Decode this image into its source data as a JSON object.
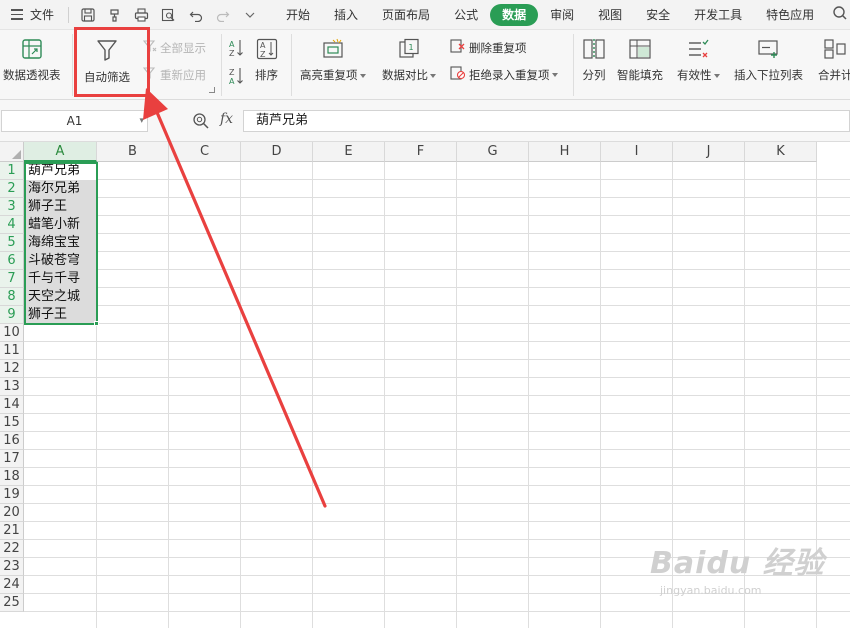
{
  "menubar": {
    "file_label": "文件",
    "tabs": [
      "开始",
      "插入",
      "页面布局",
      "公式",
      "数据",
      "审阅",
      "视图",
      "安全",
      "开发工具",
      "特色应用"
    ],
    "active_tab": "数据"
  },
  "ribbon": {
    "pivot_label": "数据透视表",
    "autofilter_label": "自动筛选",
    "show_all_label": "全部显示",
    "reapply_label": "重新应用",
    "sort_label": "排序",
    "highlight_dup_label": "高亮重复项",
    "compare_label": "数据对比",
    "remove_dup_label": "删除重复项",
    "reject_dup_label": "拒绝录入重复项",
    "split_label": "分列",
    "smart_fill_label": "智能填充",
    "validity_label": "有效性",
    "dropdown_label": "插入下拉列表",
    "merge_label": "合并计"
  },
  "formula_bar": {
    "name_box": "A1",
    "fx_label": "fx",
    "content": "葫芦兄弟"
  },
  "sheet": {
    "columns": [
      "A",
      "B",
      "C",
      "D",
      "E",
      "F",
      "G",
      "H",
      "I",
      "J",
      "K"
    ],
    "rows": [
      "1",
      "2",
      "3",
      "4",
      "5",
      "6",
      "7",
      "8",
      "9",
      "10",
      "11",
      "12",
      "13",
      "14",
      "15",
      "16",
      "17",
      "18",
      "19",
      "20",
      "21",
      "22",
      "23",
      "24",
      "25"
    ],
    "selected_column": "A",
    "cells_a": [
      "葫芦兄弟",
      "海尔兄弟",
      "狮子王",
      "蜡笔小新",
      "海绵宝宝",
      "斗破苍穹",
      "千与千寻",
      "天空之城",
      "狮子王"
    ]
  },
  "watermark": {
    "brand": "Baidu 经验",
    "url": "jingyan.baidu.com"
  },
  "colors": {
    "accent_green": "#2a9d55",
    "highlight_red": "#e9403f"
  }
}
